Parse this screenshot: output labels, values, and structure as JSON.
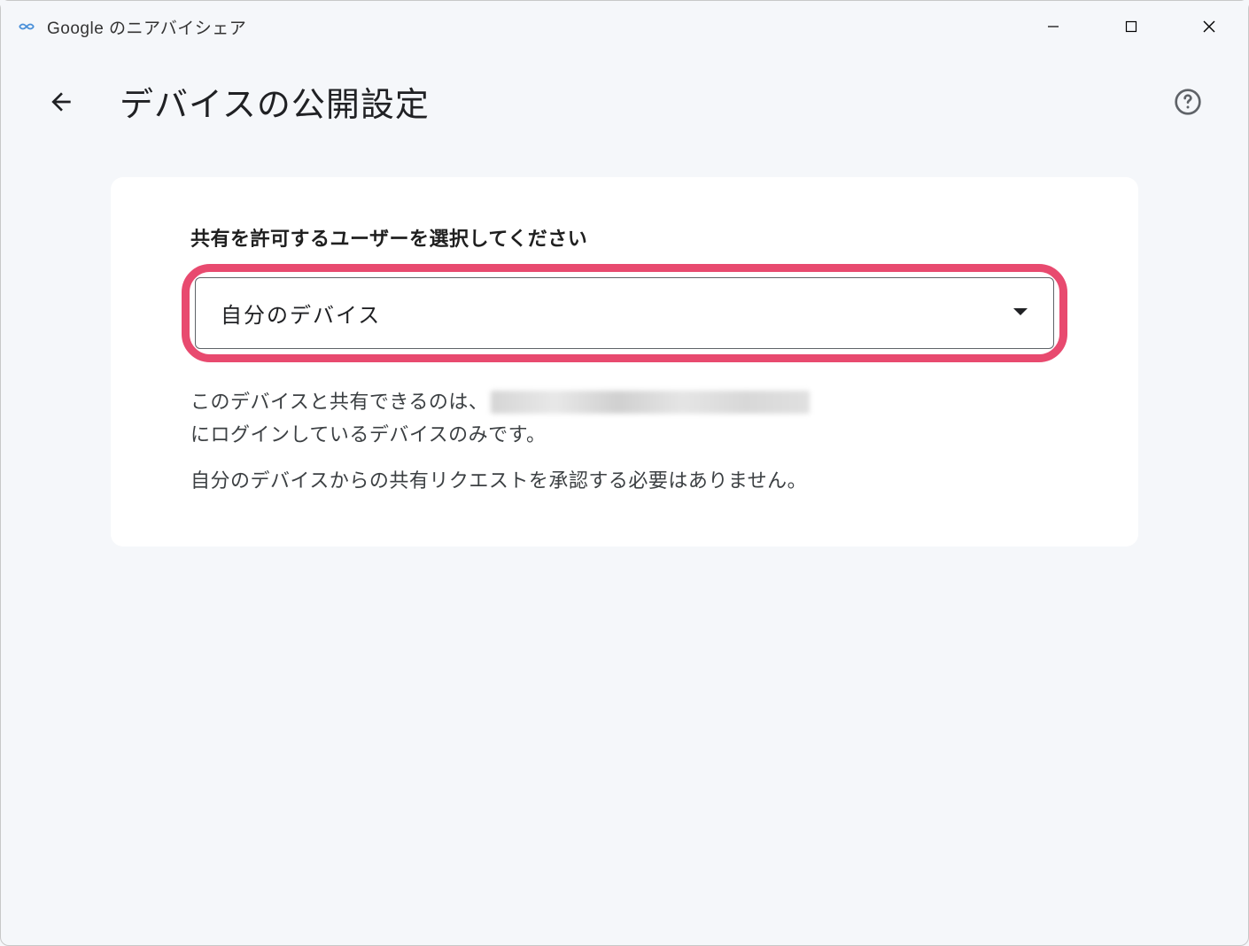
{
  "titlebar": {
    "app_title": "Google のニアバイシェア"
  },
  "header": {
    "page_title": "デバイスの公開設定"
  },
  "card": {
    "section_label": "共有を許可するユーザーを選択してください",
    "dropdown": {
      "selected_value": "自分のデバイス"
    },
    "description": {
      "line1_before": "このデバイスと共有できるのは、",
      "line1_after": "にログインしているデバイスのみです。",
      "line2": "自分のデバイスからの共有リクエストを承認する必要はありません。"
    }
  }
}
